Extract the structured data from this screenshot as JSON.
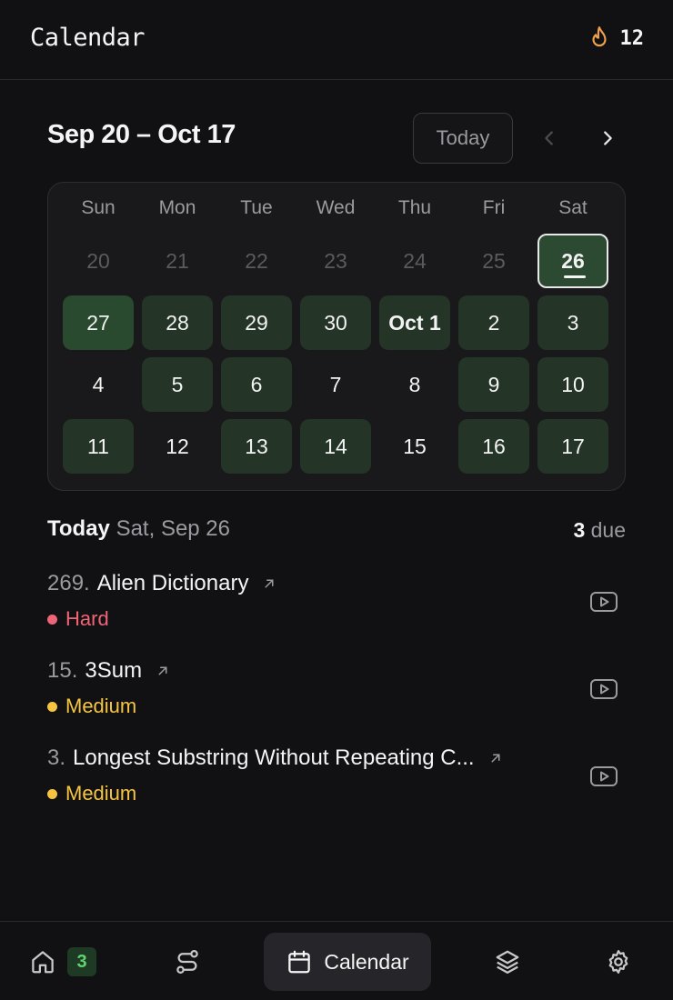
{
  "header": {
    "title": "Calendar",
    "streak": "12"
  },
  "colors": {
    "accent_due": "#243527",
    "accent_selected": "#2c4a31",
    "hard": "#f06478",
    "medium": "#f5c542",
    "flame": "#f0a04b",
    "badge": "#5fd36f"
  },
  "range": {
    "title": "Sep 20 – Oct 17",
    "today_button": "Today"
  },
  "calendar": {
    "weekdays": [
      "Sun",
      "Mon",
      "Tue",
      "Wed",
      "Thu",
      "Fri",
      "Sat"
    ],
    "weeks": [
      [
        {
          "label": "20",
          "state": "muted"
        },
        {
          "label": "21",
          "state": "muted"
        },
        {
          "label": "22",
          "state": "muted"
        },
        {
          "label": "23",
          "state": "muted"
        },
        {
          "label": "24",
          "state": "muted"
        },
        {
          "label": "25",
          "state": "muted"
        },
        {
          "label": "26",
          "state": "selected"
        }
      ],
      [
        {
          "label": "27",
          "state": "due-strong"
        },
        {
          "label": "28",
          "state": "due"
        },
        {
          "label": "29",
          "state": "due"
        },
        {
          "label": "30",
          "state": "due"
        },
        {
          "label": "Oct 1",
          "state": "due-bold"
        },
        {
          "label": "2",
          "state": "due"
        },
        {
          "label": "3",
          "state": "due"
        }
      ],
      [
        {
          "label": "4",
          "state": "normal"
        },
        {
          "label": "5",
          "state": "due"
        },
        {
          "label": "6",
          "state": "due"
        },
        {
          "label": "7",
          "state": "normal"
        },
        {
          "label": "8",
          "state": "normal"
        },
        {
          "label": "9",
          "state": "due"
        },
        {
          "label": "10",
          "state": "due"
        }
      ],
      [
        {
          "label": "11",
          "state": "due"
        },
        {
          "label": "12",
          "state": "normal"
        },
        {
          "label": "13",
          "state": "due"
        },
        {
          "label": "14",
          "state": "due"
        },
        {
          "label": "15",
          "state": "normal"
        },
        {
          "label": "16",
          "state": "due"
        },
        {
          "label": "17",
          "state": "due"
        }
      ]
    ]
  },
  "today": {
    "label": "Today",
    "date": "Sat, Sep 26",
    "due_count": "3",
    "due_label": "due"
  },
  "problems": [
    {
      "number": "269.",
      "title": "Alien Dictionary",
      "difficulty": "Hard"
    },
    {
      "number": "15.",
      "title": "3Sum",
      "difficulty": "Medium"
    },
    {
      "number": "3.",
      "title": "Longest Substring Without Repeating C...",
      "difficulty": "Medium"
    }
  ],
  "nav": {
    "home_badge": "3",
    "calendar_label": "Calendar"
  },
  "icons": {
    "flame": "flame-icon",
    "prev": "chevron-left-icon",
    "next": "chevron-right-icon",
    "external": "external-link-icon",
    "video": "video-icon",
    "home": "home-icon",
    "routes": "route-icon",
    "calendar": "calendar-icon",
    "layers": "layers-icon",
    "settings": "gear-icon"
  }
}
